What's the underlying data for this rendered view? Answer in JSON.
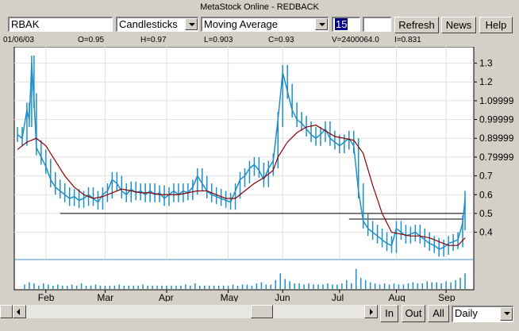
{
  "window": {
    "title": "MetaStock Online - REDBACK"
  },
  "toolbar": {
    "symbol": "RBAK",
    "chart_type": "Candlesticks",
    "indicator": "Moving Average",
    "period": "15",
    "refresh_label": "Refresh",
    "news_label": "News",
    "help_label": "Help"
  },
  "quote": {
    "date": "01/06/03",
    "open": "O=0.95",
    "high": "H=0.97",
    "low": "L=0.903",
    "close": "C=0.93",
    "volume": "V=2400064.0",
    "indicator_value": "I=0.831"
  },
  "chart_data": {
    "type": "candlestick",
    "x_tick_labels": [
      "Feb",
      "Mar",
      "Apr",
      "May",
      "Jun",
      "Jul",
      "Aug",
      "Sep"
    ],
    "y_tick_labels": [
      "1.3",
      "1.2",
      "1.09999",
      "0.99999",
      "0.89999",
      "0.79999",
      "0.7",
      "0.6",
      "0.5",
      "0.4"
    ],
    "y_ticks": [
      1.3,
      1.2,
      1.1,
      1.0,
      0.9,
      0.8,
      0.7,
      0.6,
      0.5,
      0.4
    ],
    "ylim": [
      0.28,
      1.37
    ],
    "grid": true,
    "price_series": [
      [
        0,
        0.92
      ],
      [
        2,
        0.9
      ],
      [
        4,
        1.05
      ],
      [
        5,
        1.0
      ],
      [
        6,
        1.3
      ],
      [
        7,
        1.1
      ],
      [
        8,
        0.85
      ],
      [
        10,
        0.8
      ],
      [
        12,
        0.75
      ],
      [
        14,
        0.68
      ],
      [
        16,
        0.64
      ],
      [
        18,
        0.62
      ],
      [
        20,
        0.6
      ],
      [
        22,
        0.58
      ],
      [
        24,
        0.59
      ],
      [
        26,
        0.57
      ],
      [
        28,
        0.58
      ],
      [
        30,
        0.6
      ],
      [
        32,
        0.58
      ],
      [
        34,
        0.56
      ],
      [
        36,
        0.6
      ],
      [
        38,
        0.62
      ],
      [
        40,
        0.68
      ],
      [
        42,
        0.66
      ],
      [
        44,
        0.62
      ],
      [
        46,
        0.6
      ],
      [
        48,
        0.63
      ],
      [
        50,
        0.61
      ],
      [
        52,
        0.62
      ],
      [
        54,
        0.6
      ],
      [
        56,
        0.62
      ],
      [
        58,
        0.6
      ],
      [
        60,
        0.61
      ],
      [
        62,
        0.58
      ],
      [
        64,
        0.6
      ],
      [
        66,
        0.62
      ],
      [
        68,
        0.6
      ],
      [
        70,
        0.62
      ],
      [
        72,
        0.61
      ],
      [
        74,
        0.64
      ],
      [
        76,
        0.7
      ],
      [
        78,
        0.66
      ],
      [
        80,
        0.62
      ],
      [
        82,
        0.6
      ],
      [
        84,
        0.59
      ],
      [
        86,
        0.58
      ],
      [
        88,
        0.57
      ],
      [
        90,
        0.56
      ],
      [
        92,
        0.62
      ],
      [
        94,
        0.68
      ],
      [
        96,
        0.7
      ],
      [
        98,
        0.74
      ],
      [
        100,
        0.76
      ],
      [
        102,
        0.73
      ],
      [
        104,
        0.68
      ],
      [
        106,
        0.74
      ],
      [
        108,
        0.78
      ],
      [
        110,
        1.0
      ],
      [
        112,
        1.25
      ],
      [
        114,
        1.15
      ],
      [
        116,
        1.05
      ],
      [
        118,
        1.0
      ],
      [
        120,
        0.98
      ],
      [
        122,
        0.95
      ],
      [
        124,
        0.92
      ],
      [
        126,
        0.9
      ],
      [
        128,
        0.92
      ],
      [
        130,
        0.95
      ],
      [
        132,
        0.9
      ],
      [
        134,
        0.88
      ],
      [
        136,
        0.86
      ],
      [
        138,
        0.88
      ],
      [
        140,
        0.9
      ],
      [
        142,
        0.86
      ],
      [
        144,
        0.62
      ],
      [
        146,
        0.46
      ],
      [
        148,
        0.42
      ],
      [
        150,
        0.4
      ],
      [
        152,
        0.38
      ],
      [
        154,
        0.36
      ],
      [
        156,
        0.34
      ],
      [
        158,
        0.33
      ],
      [
        160,
        0.42
      ],
      [
        162,
        0.4
      ],
      [
        164,
        0.38
      ],
      [
        166,
        0.39
      ],
      [
        168,
        0.4
      ],
      [
        170,
        0.38
      ],
      [
        172,
        0.36
      ],
      [
        174,
        0.34
      ],
      [
        176,
        0.33
      ],
      [
        178,
        0.31
      ],
      [
        180,
        0.32
      ],
      [
        182,
        0.34
      ],
      [
        184,
        0.35
      ],
      [
        186,
        0.36
      ],
      [
        188,
        0.45
      ],
      [
        189,
        0.58
      ]
    ],
    "moving_average": [
      [
        0,
        0.84
      ],
      [
        4,
        0.88
      ],
      [
        8,
        0.9
      ],
      [
        12,
        0.86
      ],
      [
        16,
        0.78
      ],
      [
        20,
        0.7
      ],
      [
        24,
        0.64
      ],
      [
        28,
        0.6
      ],
      [
        32,
        0.58
      ],
      [
        36,
        0.59
      ],
      [
        40,
        0.61
      ],
      [
        44,
        0.63
      ],
      [
        48,
        0.62
      ],
      [
        52,
        0.61
      ],
      [
        56,
        0.61
      ],
      [
        60,
        0.6
      ],
      [
        64,
        0.6
      ],
      [
        68,
        0.6
      ],
      [
        72,
        0.61
      ],
      [
        76,
        0.62
      ],
      [
        80,
        0.62
      ],
      [
        84,
        0.6
      ],
      [
        88,
        0.58
      ],
      [
        92,
        0.58
      ],
      [
        96,
        0.62
      ],
      [
        100,
        0.66
      ],
      [
        104,
        0.69
      ],
      [
        108,
        0.73
      ],
      [
        110,
        0.8
      ],
      [
        114,
        0.88
      ],
      [
        118,
        0.93
      ],
      [
        122,
        0.96
      ],
      [
        126,
        0.97
      ],
      [
        130,
        0.94
      ],
      [
        134,
        0.91
      ],
      [
        138,
        0.9
      ],
      [
        142,
        0.89
      ],
      [
        146,
        0.82
      ],
      [
        150,
        0.65
      ],
      [
        154,
        0.5
      ],
      [
        158,
        0.4
      ],
      [
        162,
        0.39
      ],
      [
        166,
        0.38
      ],
      [
        170,
        0.38
      ],
      [
        174,
        0.37
      ],
      [
        178,
        0.35
      ],
      [
        182,
        0.33
      ],
      [
        186,
        0.33
      ],
      [
        189,
        0.37
      ]
    ],
    "x_max": 190,
    "support_lines": [
      {
        "x_from": 18,
        "x_to": 189,
        "y": 0.5
      },
      {
        "x_from": 140,
        "x_to": 188,
        "y": 0.47
      }
    ],
    "volume": [
      [
        3,
        4
      ],
      [
        5,
        6
      ],
      [
        7,
        5
      ],
      [
        9,
        3
      ],
      [
        11,
        5
      ],
      [
        13,
        4
      ],
      [
        15,
        3
      ],
      [
        17,
        4
      ],
      [
        19,
        3
      ],
      [
        21,
        3
      ],
      [
        23,
        4
      ],
      [
        25,
        3
      ],
      [
        27,
        5
      ],
      [
        29,
        3
      ],
      [
        31,
        3
      ],
      [
        33,
        4
      ],
      [
        35,
        3
      ],
      [
        37,
        3
      ],
      [
        39,
        3
      ],
      [
        41,
        3
      ],
      [
        43,
        4
      ],
      [
        45,
        3
      ],
      [
        47,
        3
      ],
      [
        49,
        3
      ],
      [
        51,
        3
      ],
      [
        53,
        4
      ],
      [
        55,
        3
      ],
      [
        57,
        3
      ],
      [
        59,
        3
      ],
      [
        61,
        3
      ],
      [
        63,
        3
      ],
      [
        65,
        3
      ],
      [
        67,
        3
      ],
      [
        69,
        3
      ],
      [
        71,
        4
      ],
      [
        73,
        3
      ],
      [
        75,
        5
      ],
      [
        77,
        3
      ],
      [
        79,
        3
      ],
      [
        81,
        3
      ],
      [
        83,
        3
      ],
      [
        85,
        3
      ],
      [
        87,
        3
      ],
      [
        89,
        3
      ],
      [
        91,
        4
      ],
      [
        93,
        3
      ],
      [
        95,
        4
      ],
      [
        97,
        4
      ],
      [
        99,
        3
      ],
      [
        101,
        5
      ],
      [
        103,
        6
      ],
      [
        105,
        4
      ],
      [
        107,
        4
      ],
      [
        109,
        8
      ],
      [
        111,
        14
      ],
      [
        113,
        9
      ],
      [
        115,
        7
      ],
      [
        117,
        5
      ],
      [
        119,
        5
      ],
      [
        121,
        4
      ],
      [
        123,
        5
      ],
      [
        125,
        4
      ],
      [
        127,
        4
      ],
      [
        129,
        4
      ],
      [
        131,
        5
      ],
      [
        133,
        4
      ],
      [
        135,
        4
      ],
      [
        137,
        5
      ],
      [
        139,
        8
      ],
      [
        141,
        5
      ],
      [
        143,
        18
      ],
      [
        145,
        10
      ],
      [
        147,
        8
      ],
      [
        149,
        6
      ],
      [
        151,
        5
      ],
      [
        153,
        4
      ],
      [
        155,
        5
      ],
      [
        157,
        4
      ],
      [
        159,
        5
      ],
      [
        161,
        4
      ],
      [
        163,
        4
      ],
      [
        165,
        5
      ],
      [
        167,
        6
      ],
      [
        169,
        5
      ],
      [
        171,
        5
      ],
      [
        173,
        7
      ],
      [
        175,
        6
      ],
      [
        177,
        6
      ],
      [
        179,
        5
      ],
      [
        181,
        7
      ],
      [
        183,
        6
      ],
      [
        185,
        8
      ],
      [
        187,
        10
      ],
      [
        189,
        14
      ]
    ]
  },
  "bottom": {
    "in_label": "In",
    "out_label": "Out",
    "all_label": "All",
    "period_select": "Daily"
  },
  "colors": {
    "price": "#1f8fc8",
    "moving_average": "#8b0000",
    "grid": "#e0e0e0"
  }
}
